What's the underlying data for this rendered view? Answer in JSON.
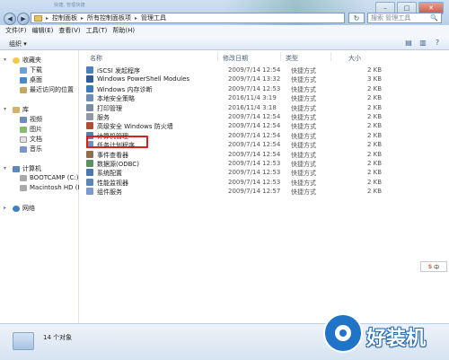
{
  "window": {
    "title_blur": "快捷, 管理快捷",
    "controls": {
      "minimize": "–",
      "maximize": "□",
      "close": "✕"
    }
  },
  "address": {
    "crumbs": [
      "控制面板",
      "所有控制面板项",
      "管理工具"
    ],
    "separator": "▸",
    "search_placeholder": "搜索 管理工具",
    "back_label": "◀",
    "forward_label": "▶",
    "refresh_label": "↻",
    "search_icon": "🔍"
  },
  "menu": [
    "文件(F)",
    "编辑(E)",
    "查看(V)",
    "工具(T)",
    "帮助(H)"
  ],
  "toolbar": {
    "organize_label": "组织 ▾",
    "icons": [
      "view-icon",
      "preview-pane-icon",
      "help-icon"
    ]
  },
  "nav": {
    "favorites": "收藏夹",
    "downloads": "下载",
    "desktop": "桌面",
    "recent": "最近访问的位置",
    "libraries": "库",
    "videos": "视频",
    "pictures": "图片",
    "documents": "文档",
    "music": "音乐",
    "computer": "计算机",
    "bootcamp": "BOOTCAMP (C:)",
    "macintosh": "Macintosh HD (D:)",
    "network": "网络"
  },
  "columns": {
    "name": "名称",
    "date": "修改日期",
    "type": "类型",
    "size": "大小"
  },
  "files": [
    {
      "name": "iSCSI 发起程序",
      "date": "2009/7/14 12:54",
      "type": "快捷方式",
      "size": "2 KB",
      "color": "#4d7fbf"
    },
    {
      "name": "Windows PowerShell Modules",
      "date": "2009/7/14 13:32",
      "type": "快捷方式",
      "size": "3 KB",
      "color": "#2f5a9e"
    },
    {
      "name": "Windows 内存诊断",
      "date": "2009/7/14 12:53",
      "type": "快捷方式",
      "size": "2 KB",
      "color": "#3c7bc4"
    },
    {
      "name": "本地安全策略",
      "date": "2016/11/4 3:19",
      "type": "快捷方式",
      "size": "2 KB",
      "color": "#6b8fb8"
    },
    {
      "name": "打印管理",
      "date": "2016/11/4 3:18",
      "type": "快捷方式",
      "size": "2 KB",
      "color": "#7a8ea3"
    },
    {
      "name": "服务",
      "date": "2009/7/14 12:54",
      "type": "快捷方式",
      "size": "2 KB",
      "color": "#8e9aa8"
    },
    {
      "name": "高级安全 Windows 防火墙",
      "date": "2009/7/14 12:54",
      "type": "快捷方式",
      "size": "2 KB",
      "color": "#b14b3a"
    },
    {
      "name": "计算机管理",
      "date": "2009/7/14 12:54",
      "type": "快捷方式",
      "size": "2 KB",
      "color": "#5a7fa8"
    },
    {
      "name": "任务计划程序",
      "date": "2009/7/14 12:54",
      "type": "快捷方式",
      "size": "2 KB",
      "color": "#6f92b9"
    },
    {
      "name": "事件查看器",
      "date": "2009/7/14 12:54",
      "type": "快捷方式",
      "size": "2 KB",
      "color": "#8b6f4a"
    },
    {
      "name": "数据源(ODBC)",
      "date": "2009/7/14 12:53",
      "type": "快捷方式",
      "size": "2 KB",
      "color": "#5e8f5e"
    },
    {
      "name": "系统配置",
      "date": "2009/7/14 12:53",
      "type": "快捷方式",
      "size": "2 KB",
      "color": "#4a78b0"
    },
    {
      "name": "性能监视器",
      "date": "2009/7/14 12:53",
      "type": "快捷方式",
      "size": "2 KB",
      "color": "#5b86bb"
    },
    {
      "name": "组件服务",
      "date": "2009/7/14 12:57",
      "type": "快捷方式",
      "size": "2 KB",
      "color": "#7b9acb"
    }
  ],
  "highlighted_item": "计算机管理",
  "status": {
    "count_text": "14 个对象"
  },
  "ime": {
    "logo": "S",
    "label": "中"
  },
  "watermark": {
    "text": "好装机"
  }
}
